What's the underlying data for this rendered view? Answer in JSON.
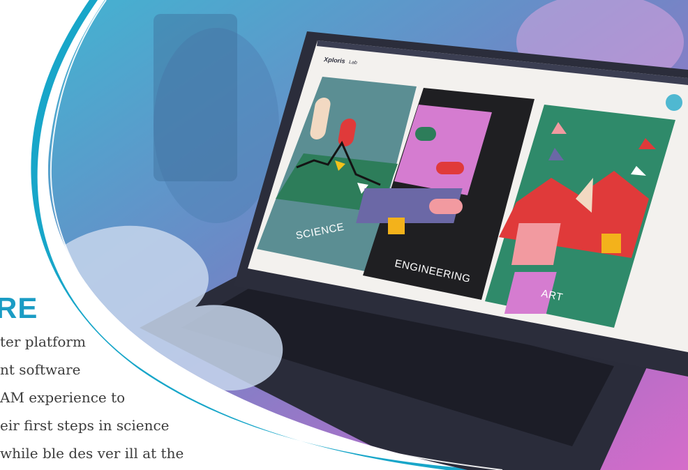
{
  "app": {
    "title": "Xploris",
    "subtitle": "Lab"
  },
  "cards": [
    {
      "label": "SCIENCE"
    },
    {
      "label": "ENGINEERING"
    },
    {
      "label": "ART"
    }
  ],
  "overlay": {
    "heading": "RE",
    "lines": [
      "ter platform",
      "nt software",
      "AM experience to",
      "eir first steps in science",
      "while ble des ver ill at the"
    ]
  },
  "colors": {
    "accent": "#1a9cc4",
    "laptop": "#2b2d3b",
    "card_science_bg": "#5b8e93",
    "card_engineering_bg": "#1f1f22",
    "card_art_bg": "#2f8a6a"
  }
}
